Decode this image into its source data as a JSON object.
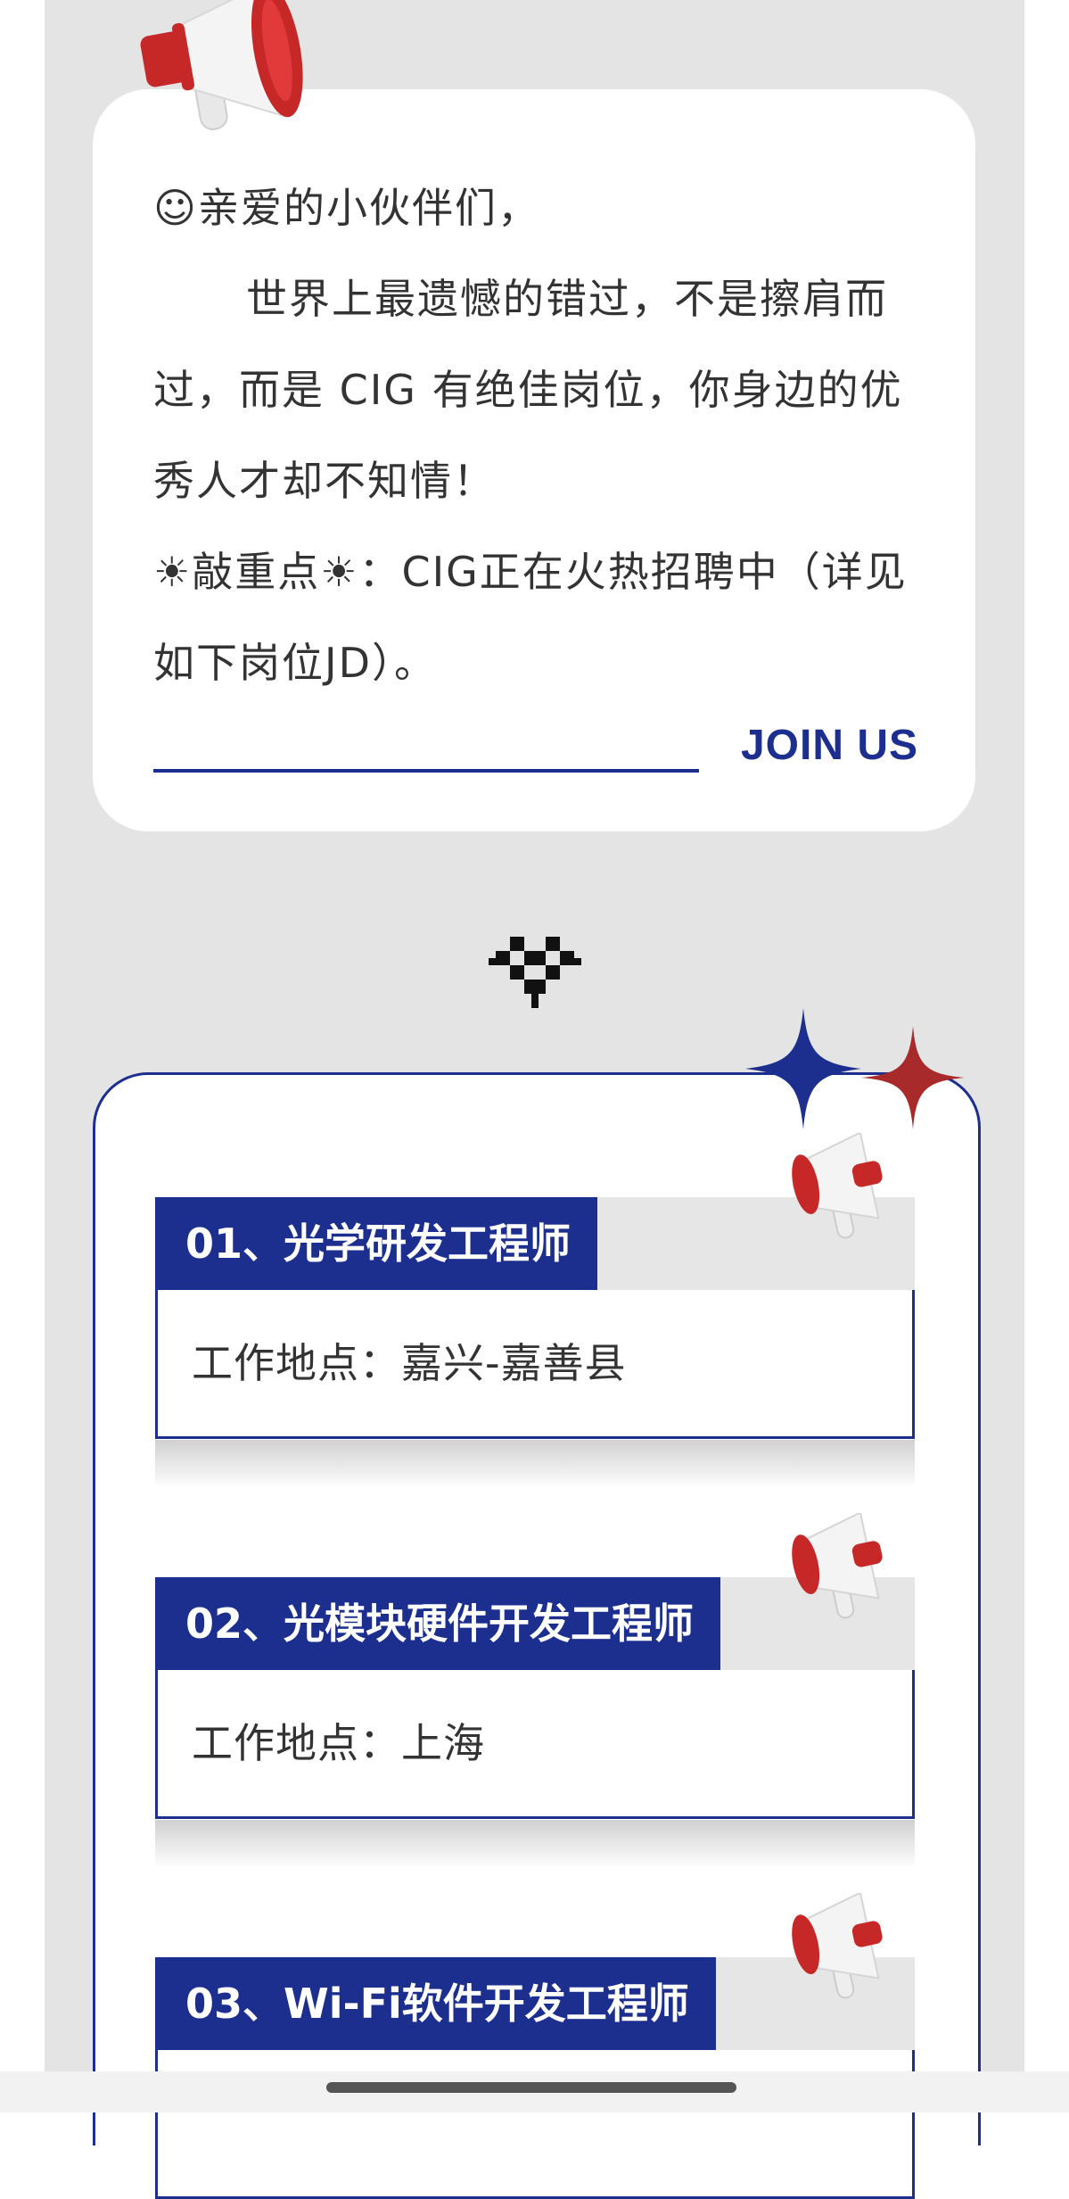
{
  "intro": {
    "greeting": "☺亲爱的小伙伴们，",
    "paragraph": "世界上最遗憾的错过，不是擦肩而过，而是 CIG 有绝佳岗位，你身边的优秀人才却不知情！",
    "highlight": "☀敲重点☀：CIG正在火热招聘中（详见如下岗位JD）。",
    "join_label": "JOIN US"
  },
  "jobs": [
    {
      "title": "01、光学研发工程师",
      "location": "工作地点：嘉兴-嘉善县"
    },
    {
      "title": "02、光模块硬件开发工程师",
      "location": "工作地点：上海"
    },
    {
      "title": "03、Wi-Fi软件开发工程师",
      "location": ""
    }
  ],
  "colors": {
    "brand_blue": "#1c2f8f",
    "accent_red": "#b83232",
    "page_gray": "#e4e4e4"
  },
  "icons": [
    "megaphone-icon",
    "pixel-heart-icon",
    "sparkle-star-icon"
  ]
}
